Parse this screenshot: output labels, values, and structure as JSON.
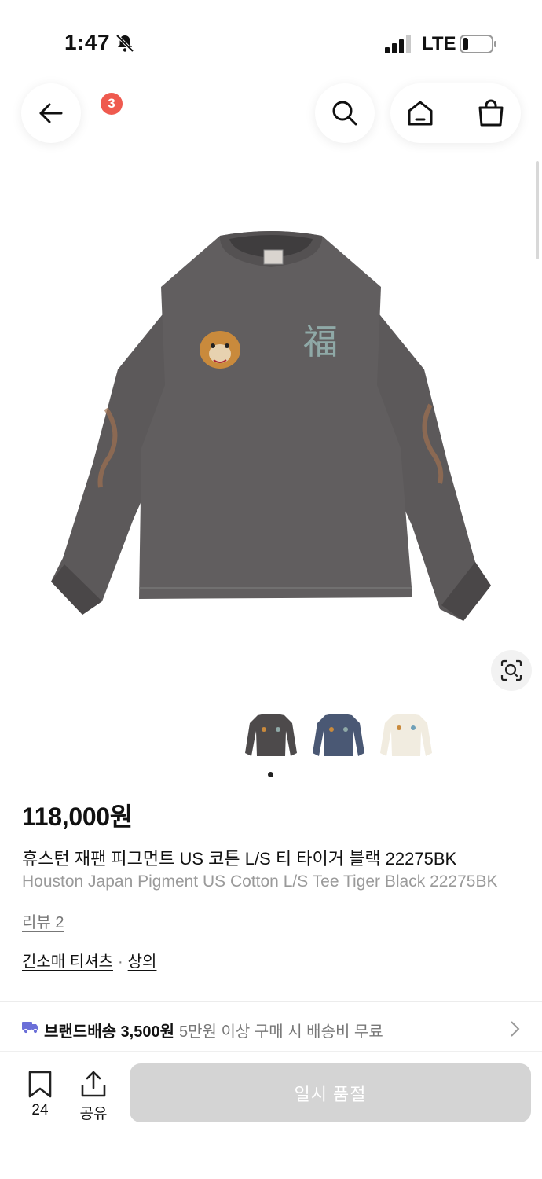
{
  "status_bar": {
    "time": "1:47",
    "network": "LTE",
    "battery_level": 0.2
  },
  "header": {
    "cart_count": "3"
  },
  "gallery": {
    "current_index": 0,
    "thumbnails": [
      "black",
      "navy",
      "white"
    ]
  },
  "product": {
    "price": "118,000원",
    "title_ko": "휴스턴 재팬 피그먼트 US 코튼 L/S 티 타이거 블랙 22275BK",
    "title_en": "Houston Japan Pigment US Cotton L/S Tee Tiger Black 22275BK",
    "review_link": "리뷰 2",
    "category_primary": "긴소매 티셔츠",
    "category_separator": "·",
    "category_secondary": "상의"
  },
  "shipping": {
    "label": "브랜드배송 3,500원",
    "condition": "5만원 이상 구매 시 배송비 무료"
  },
  "bottom_bar": {
    "like_count": "24",
    "share_label": "공유",
    "soldout_label": "일시 품절"
  },
  "colors": {
    "badge": "#ef5a4f",
    "truck": "#6b6fd8",
    "soldout_button": "#d4d4d4"
  },
  "icons": [
    "bell-slash-icon",
    "signal-icon",
    "battery-icon",
    "back-arrow-icon",
    "search-icon",
    "home-icon",
    "cart-bag-icon",
    "visual-search-icon",
    "truck-icon",
    "chevron-right-icon",
    "bookmark-icon",
    "share-icon"
  ]
}
